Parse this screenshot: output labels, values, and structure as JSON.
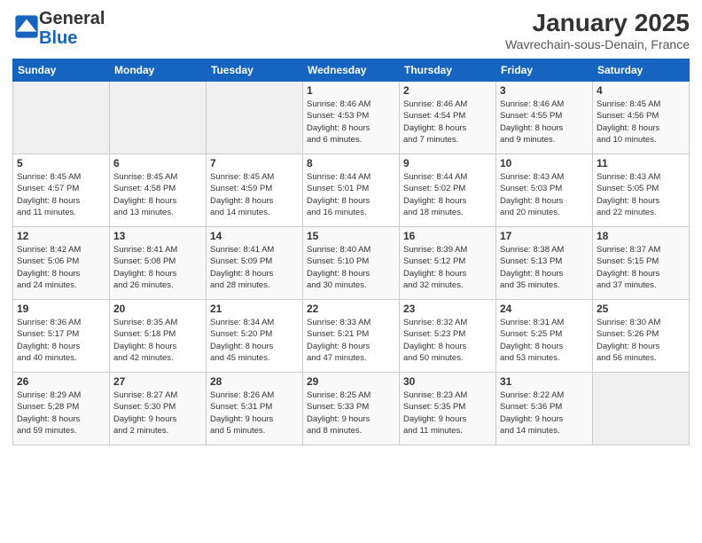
{
  "header": {
    "logo_general": "General",
    "logo_blue": "Blue",
    "month_year": "January 2025",
    "location": "Wavrechain-sous-Denain, France"
  },
  "weekdays": [
    "Sunday",
    "Monday",
    "Tuesday",
    "Wednesday",
    "Thursday",
    "Friday",
    "Saturday"
  ],
  "weeks": [
    [
      {
        "day": "",
        "info": ""
      },
      {
        "day": "",
        "info": ""
      },
      {
        "day": "",
        "info": ""
      },
      {
        "day": "1",
        "info": "Sunrise: 8:46 AM\nSunset: 4:53 PM\nDaylight: 8 hours\nand 6 minutes."
      },
      {
        "day": "2",
        "info": "Sunrise: 8:46 AM\nSunset: 4:54 PM\nDaylight: 8 hours\nand 7 minutes."
      },
      {
        "day": "3",
        "info": "Sunrise: 8:46 AM\nSunset: 4:55 PM\nDaylight: 8 hours\nand 9 minutes."
      },
      {
        "day": "4",
        "info": "Sunrise: 8:45 AM\nSunset: 4:56 PM\nDaylight: 8 hours\nand 10 minutes."
      }
    ],
    [
      {
        "day": "5",
        "info": "Sunrise: 8:45 AM\nSunset: 4:57 PM\nDaylight: 8 hours\nand 11 minutes."
      },
      {
        "day": "6",
        "info": "Sunrise: 8:45 AM\nSunset: 4:58 PM\nDaylight: 8 hours\nand 13 minutes."
      },
      {
        "day": "7",
        "info": "Sunrise: 8:45 AM\nSunset: 4:59 PM\nDaylight: 8 hours\nand 14 minutes."
      },
      {
        "day": "8",
        "info": "Sunrise: 8:44 AM\nSunset: 5:01 PM\nDaylight: 8 hours\nand 16 minutes."
      },
      {
        "day": "9",
        "info": "Sunrise: 8:44 AM\nSunset: 5:02 PM\nDaylight: 8 hours\nand 18 minutes."
      },
      {
        "day": "10",
        "info": "Sunrise: 8:43 AM\nSunset: 5:03 PM\nDaylight: 8 hours\nand 20 minutes."
      },
      {
        "day": "11",
        "info": "Sunrise: 8:43 AM\nSunset: 5:05 PM\nDaylight: 8 hours\nand 22 minutes."
      }
    ],
    [
      {
        "day": "12",
        "info": "Sunrise: 8:42 AM\nSunset: 5:06 PM\nDaylight: 8 hours\nand 24 minutes."
      },
      {
        "day": "13",
        "info": "Sunrise: 8:41 AM\nSunset: 5:08 PM\nDaylight: 8 hours\nand 26 minutes."
      },
      {
        "day": "14",
        "info": "Sunrise: 8:41 AM\nSunset: 5:09 PM\nDaylight: 8 hours\nand 28 minutes."
      },
      {
        "day": "15",
        "info": "Sunrise: 8:40 AM\nSunset: 5:10 PM\nDaylight: 8 hours\nand 30 minutes."
      },
      {
        "day": "16",
        "info": "Sunrise: 8:39 AM\nSunset: 5:12 PM\nDaylight: 8 hours\nand 32 minutes."
      },
      {
        "day": "17",
        "info": "Sunrise: 8:38 AM\nSunset: 5:13 PM\nDaylight: 8 hours\nand 35 minutes."
      },
      {
        "day": "18",
        "info": "Sunrise: 8:37 AM\nSunset: 5:15 PM\nDaylight: 8 hours\nand 37 minutes."
      }
    ],
    [
      {
        "day": "19",
        "info": "Sunrise: 8:36 AM\nSunset: 5:17 PM\nDaylight: 8 hours\nand 40 minutes."
      },
      {
        "day": "20",
        "info": "Sunrise: 8:35 AM\nSunset: 5:18 PM\nDaylight: 8 hours\nand 42 minutes."
      },
      {
        "day": "21",
        "info": "Sunrise: 8:34 AM\nSunset: 5:20 PM\nDaylight: 8 hours\nand 45 minutes."
      },
      {
        "day": "22",
        "info": "Sunrise: 8:33 AM\nSunset: 5:21 PM\nDaylight: 8 hours\nand 47 minutes."
      },
      {
        "day": "23",
        "info": "Sunrise: 8:32 AM\nSunset: 5:23 PM\nDaylight: 8 hours\nand 50 minutes."
      },
      {
        "day": "24",
        "info": "Sunrise: 8:31 AM\nSunset: 5:25 PM\nDaylight: 8 hours\nand 53 minutes."
      },
      {
        "day": "25",
        "info": "Sunrise: 8:30 AM\nSunset: 5:26 PM\nDaylight: 8 hours\nand 56 minutes."
      }
    ],
    [
      {
        "day": "26",
        "info": "Sunrise: 8:29 AM\nSunset: 5:28 PM\nDaylight: 8 hours\nand 59 minutes."
      },
      {
        "day": "27",
        "info": "Sunrise: 8:27 AM\nSunset: 5:30 PM\nDaylight: 9 hours\nand 2 minutes."
      },
      {
        "day": "28",
        "info": "Sunrise: 8:26 AM\nSunset: 5:31 PM\nDaylight: 9 hours\nand 5 minutes."
      },
      {
        "day": "29",
        "info": "Sunrise: 8:25 AM\nSunset: 5:33 PM\nDaylight: 9 hours\nand 8 minutes."
      },
      {
        "day": "30",
        "info": "Sunrise: 8:23 AM\nSunset: 5:35 PM\nDaylight: 9 hours\nand 11 minutes."
      },
      {
        "day": "31",
        "info": "Sunrise: 8:22 AM\nSunset: 5:36 PM\nDaylight: 9 hours\nand 14 minutes."
      },
      {
        "day": "",
        "info": ""
      }
    ]
  ]
}
